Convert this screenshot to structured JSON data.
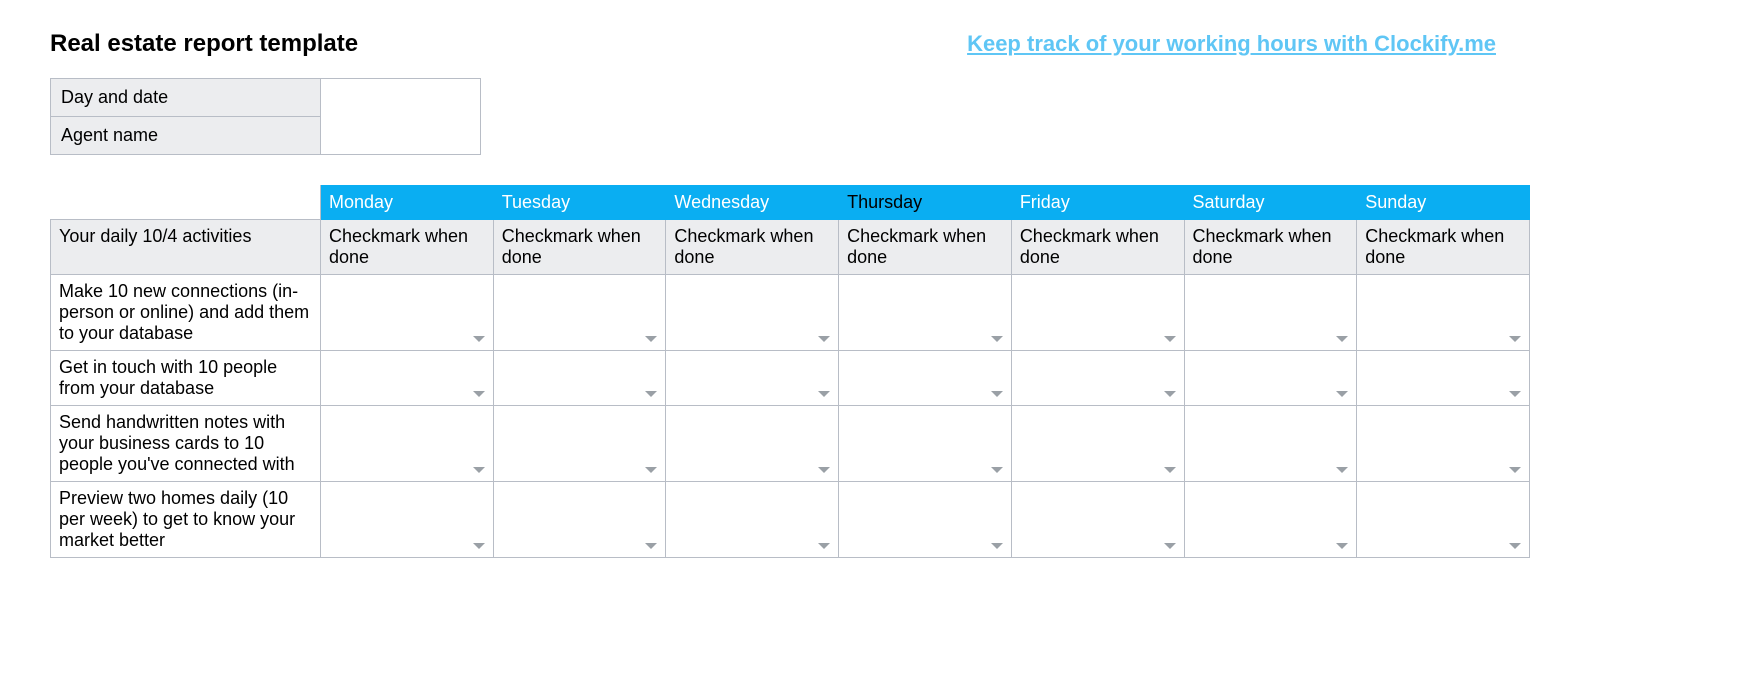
{
  "header": {
    "title": "Real estate report template",
    "promo_link": "Keep track of your working hours with Clockify.me"
  },
  "info": {
    "day_date_label": "Day and date",
    "day_date_value": "",
    "agent_name_label": "Agent name",
    "agent_name_value": ""
  },
  "days": [
    {
      "name": "Monday",
      "sub": "Checkmark when done"
    },
    {
      "name": "Tuesday",
      "sub": "Checkmark when done"
    },
    {
      "name": "Wednesday",
      "sub": "Checkmark when done"
    },
    {
      "name": "Thursday",
      "sub": "Checkmark when done"
    },
    {
      "name": "Friday",
      "sub": "Checkmark when done"
    },
    {
      "name": "Saturday",
      "sub": "Checkmark when done"
    },
    {
      "name": "Sunday",
      "sub": "Checkmark when done"
    }
  ],
  "activities_header": "Your daily 10/4 activities",
  "activities": [
    "Make 10 new connections (in-person or online) and add them to your database",
    "Get in touch with 10 people from your database",
    "Send handwritten notes with your business cards to 10 people you've connected with",
    "Preview two homes daily (10 per week) to get to know your market better"
  ]
}
